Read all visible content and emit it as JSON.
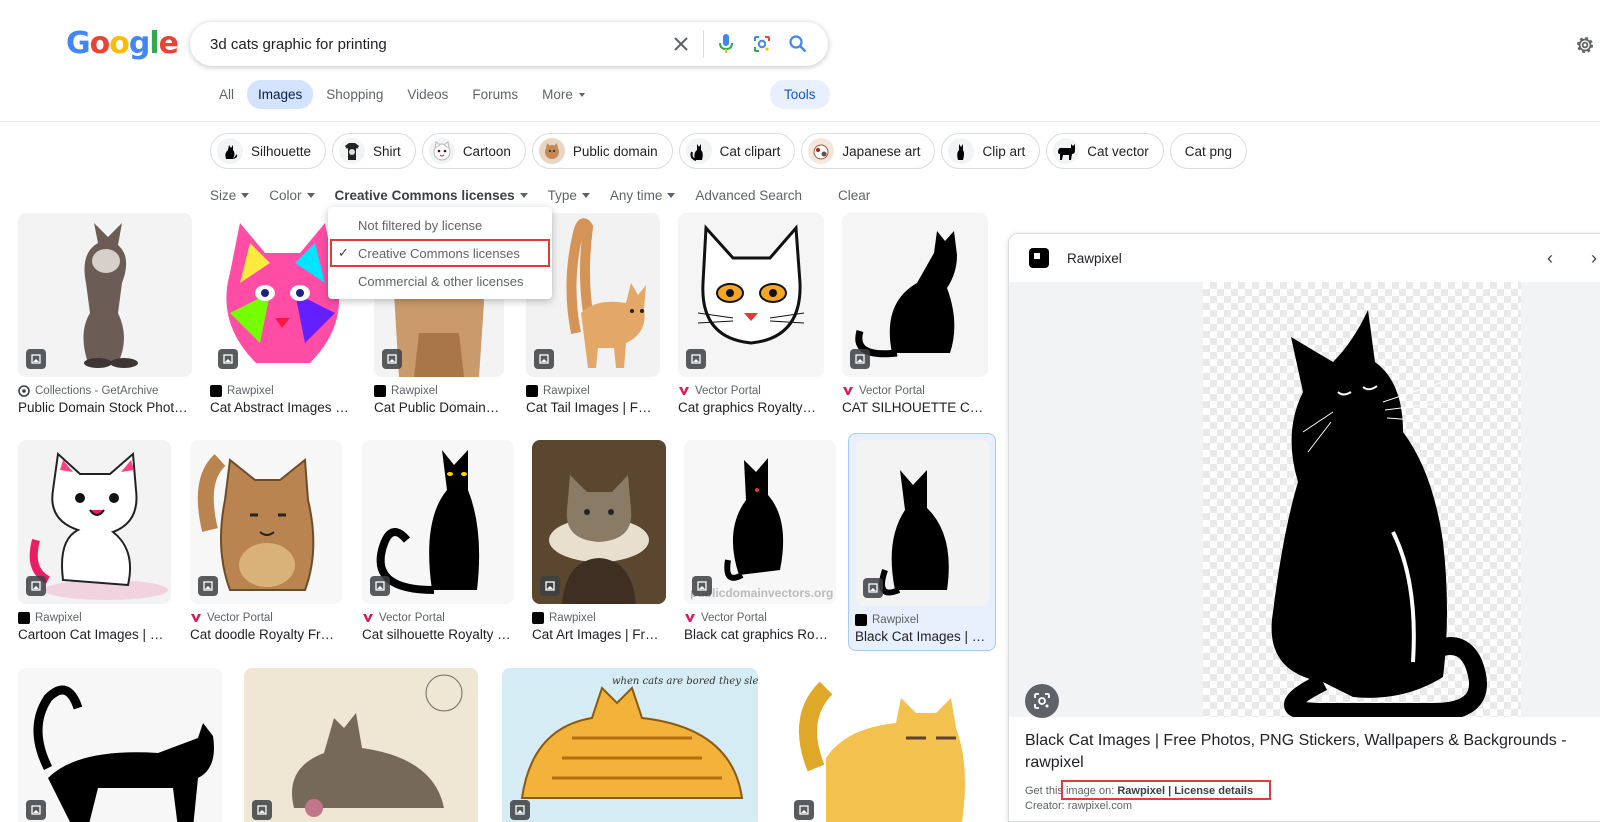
{
  "logo": {
    "g1": "G",
    "o1": "o",
    "o2": "o",
    "g2": "g",
    "l": "l",
    "e": "e"
  },
  "search": {
    "query": "3d cats graphic for printing"
  },
  "tabs": [
    {
      "label": "All",
      "active": false
    },
    {
      "label": "Images",
      "active": true
    },
    {
      "label": "Shopping",
      "active": false
    },
    {
      "label": "Videos",
      "active": false
    },
    {
      "label": "Forums",
      "active": false
    },
    {
      "label": "More",
      "active": false
    }
  ],
  "tools_label": "Tools",
  "chips": [
    "Silhouette",
    "Shirt",
    "Cartoon",
    "Public domain",
    "Cat clipart",
    "Japanese art",
    "Clip art",
    "Cat vector",
    "Cat png"
  ],
  "filters": {
    "size": "Size",
    "color": "Color",
    "license": "Creative Commons licenses",
    "type": "Type",
    "time": "Any time",
    "advanced": "Advanced Search",
    "clear": "Clear"
  },
  "license_dropdown": {
    "options": [
      "Not filtered by license",
      "Creative Commons licenses",
      "Commercial & other licenses"
    ],
    "selected": "Creative Commons licenses"
  },
  "results": [
    {
      "source": "Collections - GetArchive",
      "title": "Public Domain Stock Phot…"
    },
    {
      "source": "Rawpixel",
      "title": "Cat Abstract Images …"
    },
    {
      "source": "Rawpixel",
      "title": "Cat Public Domain…"
    },
    {
      "source": "Rawpixel",
      "title": "Cat Tail Images | F…"
    },
    {
      "source": "Vector Portal",
      "title": "Cat graphics Royalty…"
    },
    {
      "source": "Vector Portal",
      "title": "CAT SILHOUETTE C…"
    },
    {
      "source": "Rawpixel",
      "title": "Cartoon Cat Images | …"
    },
    {
      "source": "Vector Portal",
      "title": "Cat doodle Royalty Fr…"
    },
    {
      "source": "Vector Portal",
      "title": "Cat silhouette Royalty …"
    },
    {
      "source": "Rawpixel",
      "title": "Cat Art Images | Fr…"
    },
    {
      "source": "Vector Portal",
      "title": "Black cat graphics Ro…"
    },
    {
      "source": "Rawpixel",
      "title": "Black Cat Images | …"
    }
  ],
  "watermark": "publicdomainvectors.org",
  "caption_small": "when cats are bored they sleep",
  "panel": {
    "source": "Rawpixel",
    "title": "Black Cat Images | Free Photos, PNG Stickers, Wallpapers & Backgrounds - rawpixel",
    "get_prefix": "Get this image on: ",
    "get_links": "Rawpixel | License details",
    "creator": "Creator: rawpixel.com"
  },
  "colors": {
    "accent": "#0b57d0",
    "chip_active": "#d3e3fd",
    "highlight_box": "#e53935"
  }
}
